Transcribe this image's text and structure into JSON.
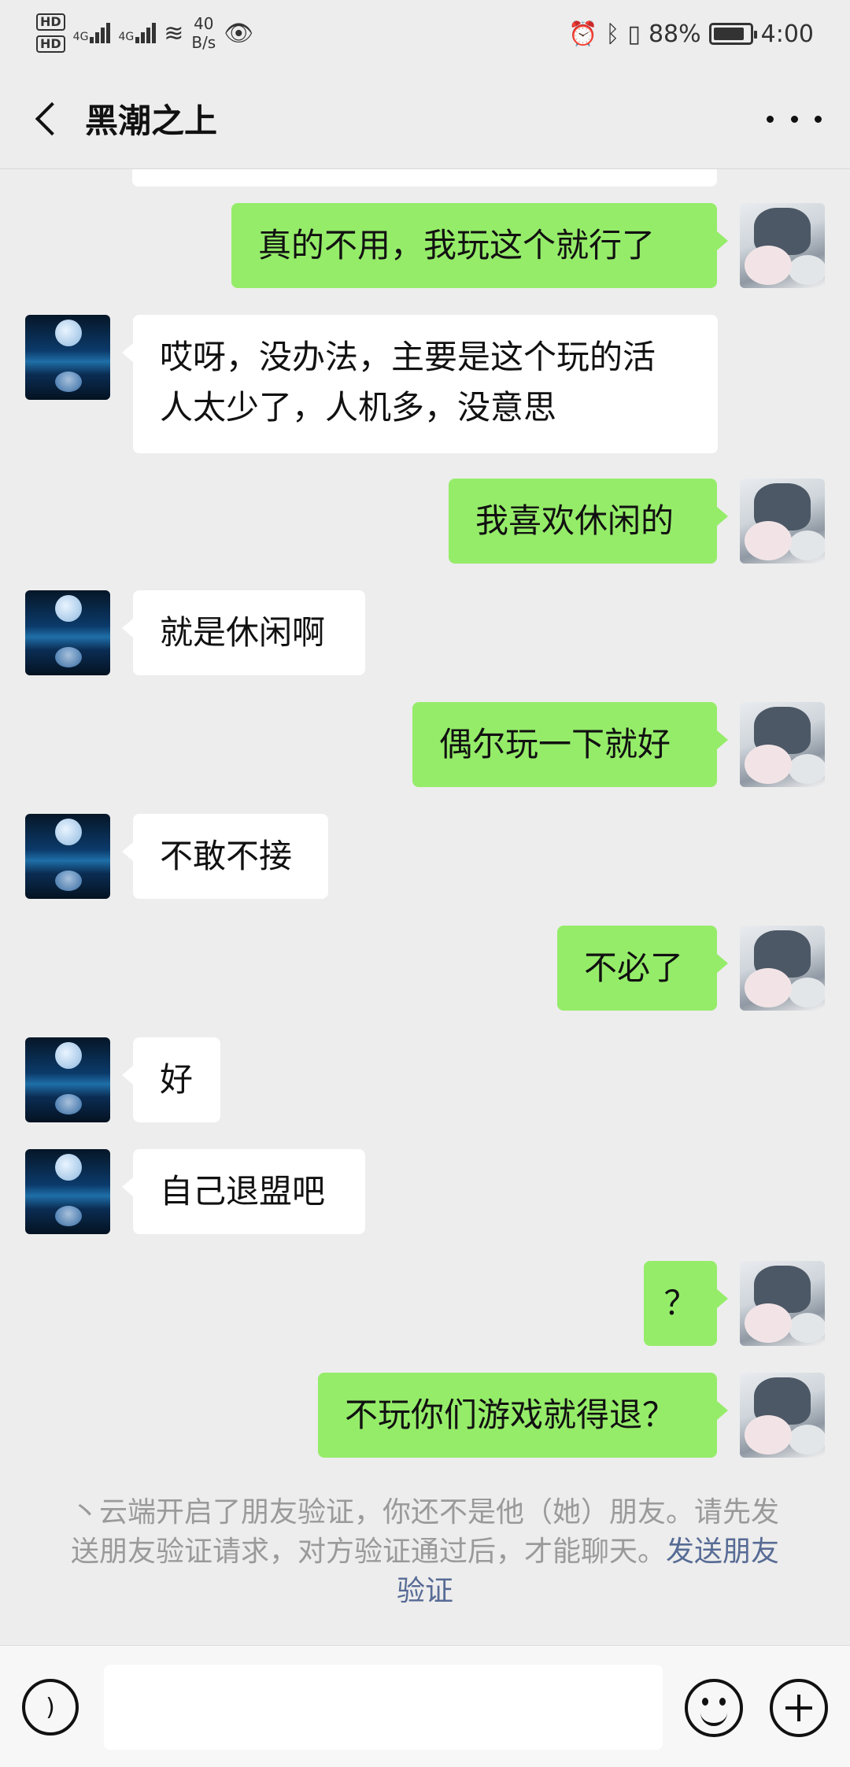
{
  "status_bar": {
    "network_speed_value": "40",
    "network_speed_unit": "B/s",
    "battery_percent": "88%",
    "time": "4:00",
    "battery_level": 0.88
  },
  "header": {
    "title": "黑潮之上"
  },
  "messages": [
    {
      "side": "out",
      "text": "真的不用，我玩这个就行了"
    },
    {
      "side": "in",
      "text": "哎呀，没办法，主要是这个玩的活\n人太少了，人机多，没意思"
    },
    {
      "side": "out",
      "text": "我喜欢休闲的"
    },
    {
      "side": "in",
      "text": "就是休闲啊"
    },
    {
      "side": "out",
      "text": "偶尔玩一下就好"
    },
    {
      "side": "in",
      "text": "不敢不接"
    },
    {
      "side": "out",
      "text": "不必了"
    },
    {
      "side": "in",
      "text": "好"
    },
    {
      "side": "in",
      "text": "自己退盟吧"
    },
    {
      "side": "out",
      "text": "？"
    },
    {
      "side": "out",
      "text": "不玩你们游戏就得退？"
    }
  ],
  "system_note": {
    "text": "丶云端开启了朋友验证，你还不是他（她）朋友。请先发送朋友验证请求，对方验证通过后，才能聊天。",
    "link": "发送朋友验证"
  },
  "input_bar": {
    "voice_icon": "voice-icon",
    "emoji_icon": "emoji-icon",
    "plus_icon": "plus-icon"
  },
  "colors": {
    "background": "#ededed",
    "outgoing_bubble": "#95ec69",
    "incoming_bubble": "#ffffff",
    "link": "#576b95"
  }
}
